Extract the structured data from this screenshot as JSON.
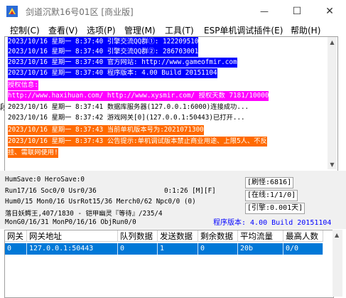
{
  "window": {
    "title": "剑道沉默16号01区 [商业版]",
    "icon": "app-icon",
    "minimize_glyph": "—",
    "maximize_glyph": "☐",
    "close_glyph": "✕"
  },
  "menu": [
    "控制(C)",
    "查看(V)",
    "选项(P)",
    "管理(M)",
    "工具(T)",
    "ESP单机调试插件(E)",
    "帮助(H)"
  ],
  "log": [
    {
      "text": "2023/10/16 星期一 8:37:40 引擎交流QQ群①: 122209510",
      "bg": "#0000ff",
      "fg": "#ffffff"
    },
    {
      "text": "2023/10/16 星期一 8:37:40 引擎交流QQ群②: 286703001",
      "bg": "#0000ff",
      "fg": "#ffffff"
    },
    {
      "text": "2023/10/16 星期一 8:37:40 官方网站: http://www.gameofmir.com",
      "bg": "#0000ff",
      "fg": "#ffffff"
    },
    {
      "text": "2023/10/16 星期一 8:37:40 程序版本: 4.00 Build 20151104",
      "bg": "#0000ff",
      "fg": "#ffffff"
    },
    {
      "text": "授权信息:",
      "bg": "#ff00ff",
      "fg": "#ffffff"
    },
    {
      "text": "http://www.haxihuan.com/ http://www.xysmir.com/ 授权天数 7181/10000",
      "bg": "#ff00ff",
      "fg": "#ffffff"
    },
    {
      "text": "2023/10/16 星期一 8:37:41 数据库服务器(127.0.0.1:6000)连接成功...",
      "bg": "#ffffff",
      "fg": "#000000"
    },
    {
      "text": "2023/10/16 星期一 8:37:42 游戏网关[0](127.0.0.1:50443)已打开...",
      "bg": "#ffffff",
      "fg": "#000000"
    },
    {
      "text": "2023/10/16 星期一 8:37:43 当前单机版本号为:2021071300",
      "bg": "#ff6a00",
      "fg": "#ffffff"
    },
    {
      "text": "2023/10/16 星期一 8:37:43 公告提示:单机调试版本禁止商业用途、上限5人、不反",
      "bg": "#ff6a00",
      "fg": "#ffffff"
    },
    {
      "text": "挂、需联网使用!",
      "bg": "#ff6a00",
      "fg": "#ffffff"
    }
  ],
  "left_partial": "段",
  "status": {
    "line1": "HumSave:0 HeroSave:0",
    "line2_left": "Run17/16 Soc0/0 Usr0/36",
    "line2_mid": "0:1:26 [M][F]",
    "line3": "Hum0/15 Mon0/16 UsrRot15/36 Merch0/62 Npc0/0 (0)",
    "line4": "落日妖鳄王,407/1830 - 铠甲幽灵『等待』/235/4",
    "line5": "MonG0/16/31 MonP0/16/16 ObjRun0/0",
    "refresh": "[刷怪:6816]",
    "online": "[在线:1/1/0]",
    "engine": "[引擎:0.001天]",
    "version": "程序版本: 4.00 Build 20151104"
  },
  "table": {
    "headers": [
      "网关",
      "网关地址",
      "队列数据",
      "发送数据",
      "剩余数据",
      "平均流量",
      "最高人数"
    ],
    "rows": [
      [
        "0",
        "127.0.0.1:50443",
        "0",
        "1",
        "0",
        "20b",
        "0/0"
      ]
    ]
  }
}
